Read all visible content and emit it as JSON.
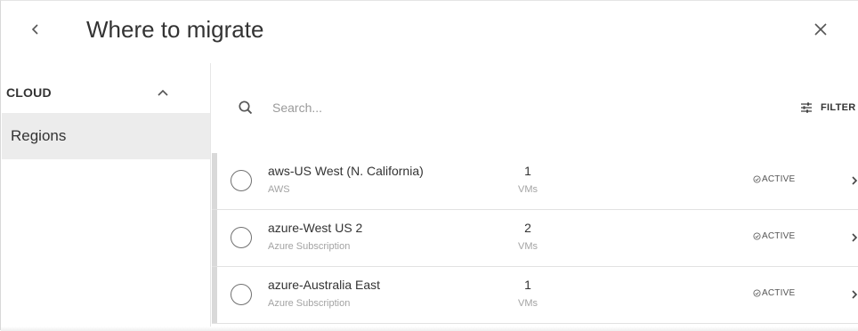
{
  "header": {
    "title": "Where to migrate",
    "back_icon": "chevron-left-icon",
    "close_icon": "close-icon"
  },
  "sidebar": {
    "section_title": "CLOUD",
    "section_icon": "chevron-up-icon",
    "items": [
      {
        "label": "Regions",
        "selected": true
      }
    ]
  },
  "search": {
    "placeholder": "Search...",
    "value": ""
  },
  "filter": {
    "label": "FILTER",
    "icon": "filter-sliders-icon"
  },
  "rows": [
    {
      "name": "aws-US West (N. California)",
      "provider": "AWS",
      "count": "1",
      "unit": "VMs",
      "status": "ACTIVE"
    },
    {
      "name": "azure-West US 2",
      "provider": "Azure Subscription",
      "count": "2",
      "unit": "VMs",
      "status": "ACTIVE"
    },
    {
      "name": "azure-Australia East",
      "provider": "Azure Subscription",
      "count": "1",
      "unit": "VMs",
      "status": "ACTIVE"
    }
  ],
  "colors": {
    "text": "#333333",
    "muted": "#a3a3a3",
    "selected_bg": "#ececec",
    "row_accent": "#d9d9d9"
  }
}
